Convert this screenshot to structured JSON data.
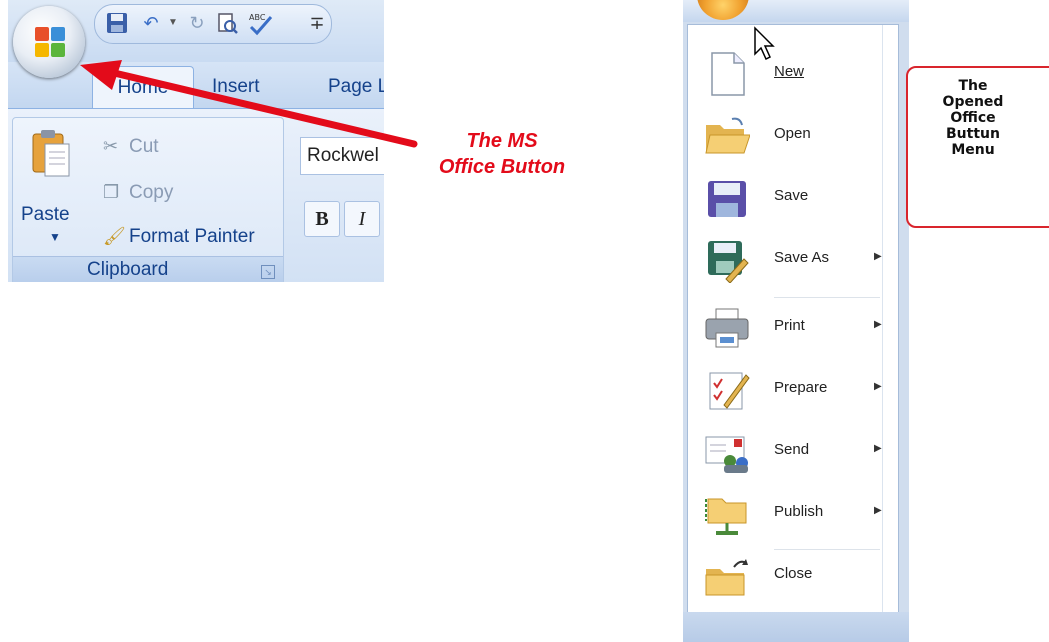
{
  "ribbon": {
    "tabs": {
      "home": "Home",
      "insert": "Insert",
      "page_layout": "Page L"
    },
    "quick_access": {
      "customize_glyph": "∓"
    },
    "clipboard": {
      "paste_label": "Paste",
      "cut_label": "Cut",
      "copy_label": "Copy",
      "format_painter_label": "Format Painter",
      "group_title": "Clipboard"
    },
    "font": {
      "font_name": "Rockwel",
      "bold": "B",
      "italic": "I"
    }
  },
  "annotation": {
    "line1": "The MS",
    "line2": "Office Button",
    "color": "#e30b1a"
  },
  "office_menu": {
    "items": [
      {
        "label": "New",
        "has_submenu": false
      },
      {
        "label": "Open",
        "has_submenu": false
      },
      {
        "label": "Save",
        "has_submenu": false
      },
      {
        "label": "Save As",
        "has_submenu": true
      },
      {
        "label": "Print",
        "has_submenu": true
      },
      {
        "label": "Prepare",
        "has_submenu": true
      },
      {
        "label": "Send",
        "has_submenu": true
      },
      {
        "label": "Publish",
        "has_submenu": true
      },
      {
        "label": "Close",
        "has_submenu": false
      }
    ],
    "submenu_glyph": "▶"
  },
  "info_box": {
    "lines": [
      "The",
      "Opened",
      "Office",
      "Buttun",
      "Menu"
    ],
    "border_color": "#d9252d"
  },
  "icons": [
    "office-logo-icon",
    "save-icon",
    "undo-icon",
    "redo-icon",
    "print-preview-icon",
    "spelling-icon",
    "paste-icon",
    "cut-icon",
    "copy-icon",
    "format-painter-icon",
    "dialog-launcher-icon",
    "new-document-icon",
    "open-folder-icon",
    "save-disk-icon",
    "save-as-icon",
    "printer-icon",
    "prepare-icon",
    "send-icon",
    "publish-icon",
    "close-folder-icon",
    "cursor-icon"
  ]
}
